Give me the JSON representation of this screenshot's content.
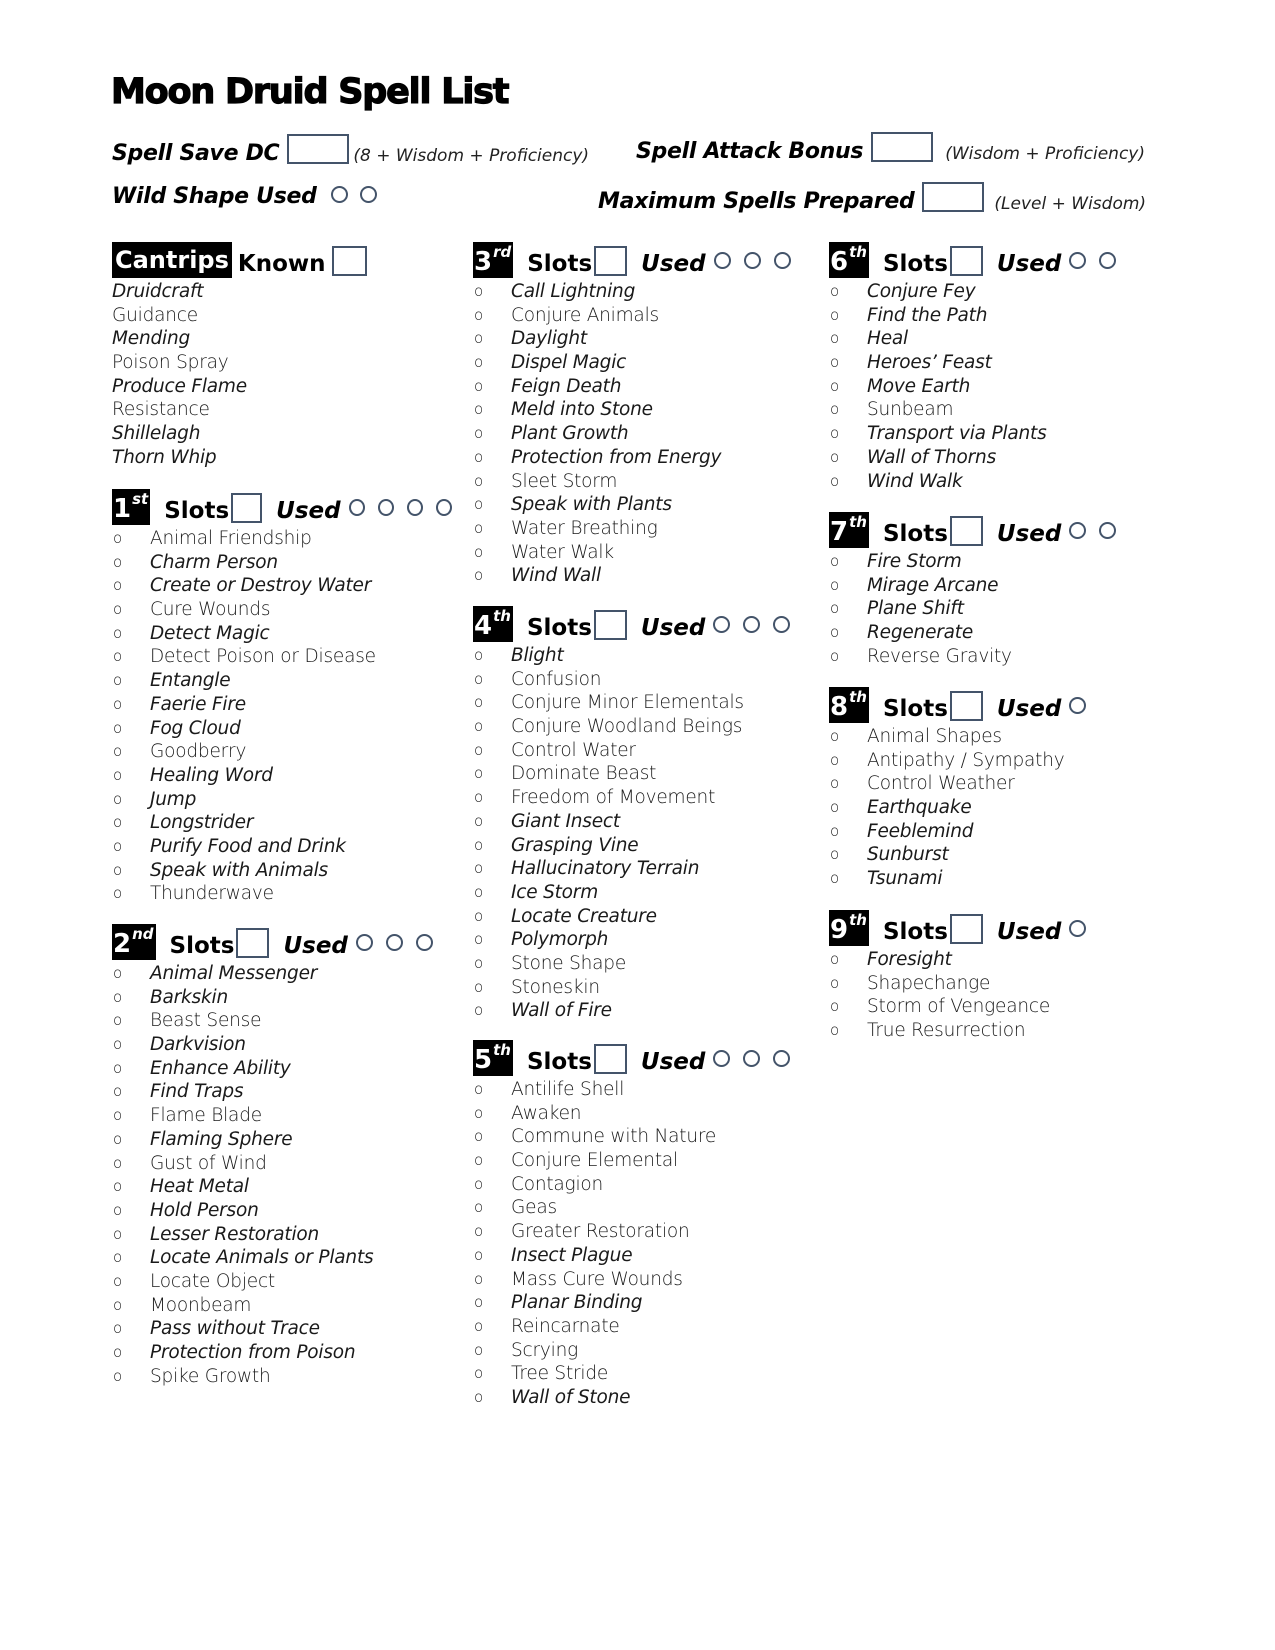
{
  "title": "Moon Druid Spell List",
  "stats": {
    "spell_save_dc": {
      "label": "Spell Save DC",
      "value": "",
      "note": "(8 + Wisdom + Proficiency)"
    },
    "spell_attack_bonus": {
      "label": "Spell Attack Bonus",
      "value": "",
      "note": "(Wisdom + Proficiency)"
    },
    "wild_shape_used": {
      "label": "Wild Shape Used",
      "uses": 2
    },
    "max_spells_prepared": {
      "label": "Maximum Spells Prepared",
      "value": "",
      "note": "(Level + Wisdom)"
    }
  },
  "labels": {
    "slots": "Slots",
    "used": "Used",
    "known": "Known",
    "bullet": "o"
  },
  "cantrips": {
    "heading": "Cantrips",
    "known_value": "",
    "spells": [
      "Druidcraft",
      "Guidance",
      "Mending",
      "Poison Spray",
      "Produce Flame",
      "Resistance",
      "Shillelagh",
      "Thorn Whip"
    ]
  },
  "levels": [
    {
      "level": "1",
      "suffix": "st",
      "slot_circles": 4,
      "slots_value": "",
      "spells": [
        "Animal Friendship",
        "Charm Person",
        "Create or Destroy Water",
        "Cure Wounds",
        "Detect Magic",
        "Detect Poison or Disease",
        "Entangle",
        "Faerie Fire",
        "Fog Cloud",
        "Goodberry",
        "Healing Word",
        "Jump",
        "Longstrider",
        "Purify Food and Drink",
        "Speak with Animals",
        "Thunderwave"
      ]
    },
    {
      "level": "2",
      "suffix": "nd",
      "slot_circles": 3,
      "slots_value": "",
      "spells": [
        "Animal Messenger",
        "Barkskin",
        "Beast Sense",
        "Darkvision",
        "Enhance Ability",
        "Find Traps",
        "Flame Blade",
        "Flaming Sphere",
        "Gust of Wind",
        "Heat Metal",
        "Hold Person",
        "Lesser Restoration",
        "Locate Animals or Plants",
        "Locate Object",
        "Moonbeam",
        "Pass without Trace",
        "Protection from Poison",
        "Spike Growth"
      ]
    },
    {
      "level": "3",
      "suffix": "rd",
      "slot_circles": 3,
      "slots_value": "",
      "spells": [
        "Call Lightning",
        "Conjure Animals",
        "Daylight",
        "Dispel Magic",
        "Feign Death",
        "Meld into Stone",
        "Plant Growth",
        "Protection from Energy",
        "Sleet Storm",
        "Speak with Plants",
        "Water Breathing",
        "Water Walk",
        "Wind Wall"
      ]
    },
    {
      "level": "4",
      "suffix": "th",
      "slot_circles": 3,
      "slots_value": "",
      "spells": [
        "Blight",
        "Confusion",
        "Conjure Minor Elementals",
        "Conjure Woodland Beings",
        "Control Water",
        "Dominate Beast",
        "Freedom of Movement",
        "Giant Insect",
        "Grasping Vine",
        "Hallucinatory Terrain",
        "Ice Storm",
        "Locate Creature",
        "Polymorph",
        "Stone Shape",
        "Stoneskin",
        "Wall of Fire"
      ]
    },
    {
      "level": "5",
      "suffix": "th",
      "slot_circles": 3,
      "slots_value": "",
      "spells": [
        "Antilife Shell",
        "Awaken",
        "Commune with Nature",
        "Conjure Elemental",
        "Contagion",
        "Geas",
        "Greater Restoration",
        "Insect Plague",
        "Mass Cure Wounds",
        "Planar Binding",
        "Reincarnate",
        "Scrying",
        "Tree Stride",
        "Wall of Stone"
      ]
    },
    {
      "level": "6",
      "suffix": "th",
      "slot_circles": 2,
      "slots_value": "",
      "spells": [
        "Conjure Fey",
        "Find the Path",
        "Heal",
        "Heroes’ Feast",
        "Move Earth",
        "Sunbeam",
        "Transport via Plants",
        "Wall of Thorns",
        "Wind Walk"
      ]
    },
    {
      "level": "7",
      "suffix": "th",
      "slot_circles": 2,
      "slots_value": "",
      "spells": [
        "Fire Storm",
        "Mirage Arcane",
        "Plane Shift",
        "Regenerate",
        "Reverse Gravity"
      ]
    },
    {
      "level": "8",
      "suffix": "th",
      "slot_circles": 1,
      "slots_value": "",
      "spells": [
        "Animal Shapes",
        "Antipathy / Sympathy",
        "Control Weather",
        "Earthquake",
        "Feeblemind",
        "Sunburst",
        "Tsunami"
      ]
    },
    {
      "level": "9",
      "suffix": "th",
      "slot_circles": 1,
      "slots_value": "",
      "spells": [
        "Foresight",
        "Shapechange",
        "Storm of Vengeance",
        "True Resurrection"
      ]
    }
  ],
  "colors": {
    "box_border": "#44546a",
    "level_badge_bg": "#000000",
    "level_badge_text": "#ffffff"
  }
}
